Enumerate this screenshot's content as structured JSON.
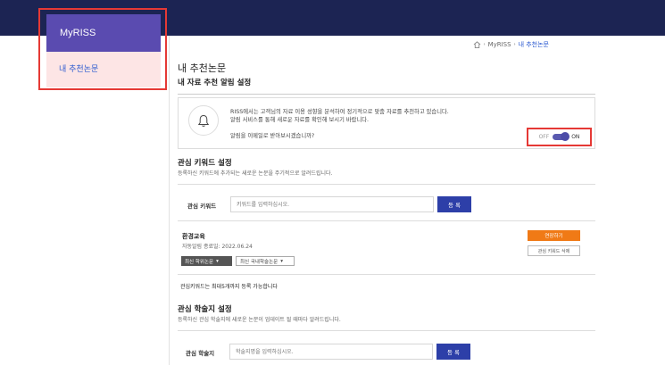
{
  "sidebar": {
    "title": "MyRISS",
    "items": [
      {
        "label": "내 추천논문"
      }
    ]
  },
  "breadcrumb": {
    "items": [
      "MyRISS",
      "내 추천논문"
    ]
  },
  "page": {
    "title": "내 추천논문"
  },
  "alert_settings": {
    "title": "내 자료 추천 알림 설정",
    "line1": "RISS에서는 고객님의 자료 이용 성향을 분석하여 정기적으로 맞춤 자료를 추천하고 있습니다.",
    "line2": "알림 서비스를 통해 새로운 자료를 확인해 보시기 바랍니다.",
    "question": "알림을 이메일로 받아보시겠습니까?",
    "toggle_off": "OFF",
    "toggle_on": "ON",
    "toggle_state": "on"
  },
  "keyword_settings": {
    "title": "관심 키워드 설정",
    "desc": "등록하신 키워드에 추가되는 새로운 논문을 주기적으로 알려드립니다.",
    "label": "관심 키워드",
    "placeholder": "키워드를 입력하십시오.",
    "register": "등 록",
    "entry": {
      "name": "환경교육",
      "expiry": "자동알림 종료일: 2022.06.24",
      "select1": "최신 학위논문",
      "select2": "최신 국내학술논문",
      "extend": "연장하기",
      "delete": "관심 키워드 삭제"
    },
    "limit": "관심키워드는 최대5개까지 등록 가능합니다"
  },
  "journal_settings": {
    "title": "관심 학술지 설정",
    "desc": "등록하신 관심 학술지에 새로운 논문이 업데이트 될 때마다 알려드립니다.",
    "label": "관심 학술지",
    "placeholder": "학술지명을 입력하십시오.",
    "register": "등 록"
  },
  "colors": {
    "topbar": "#1c2453",
    "sidebar_head": "#5a4bb0",
    "sidebar_active_bg": "#fde5e5",
    "primary_button": "#2d3fa8",
    "extend_button": "#f07a16",
    "highlight": "#e53935"
  },
  "icons": [
    "home-icon",
    "bell-icon",
    "chevron-right-icon",
    "caret-down-icon"
  ]
}
